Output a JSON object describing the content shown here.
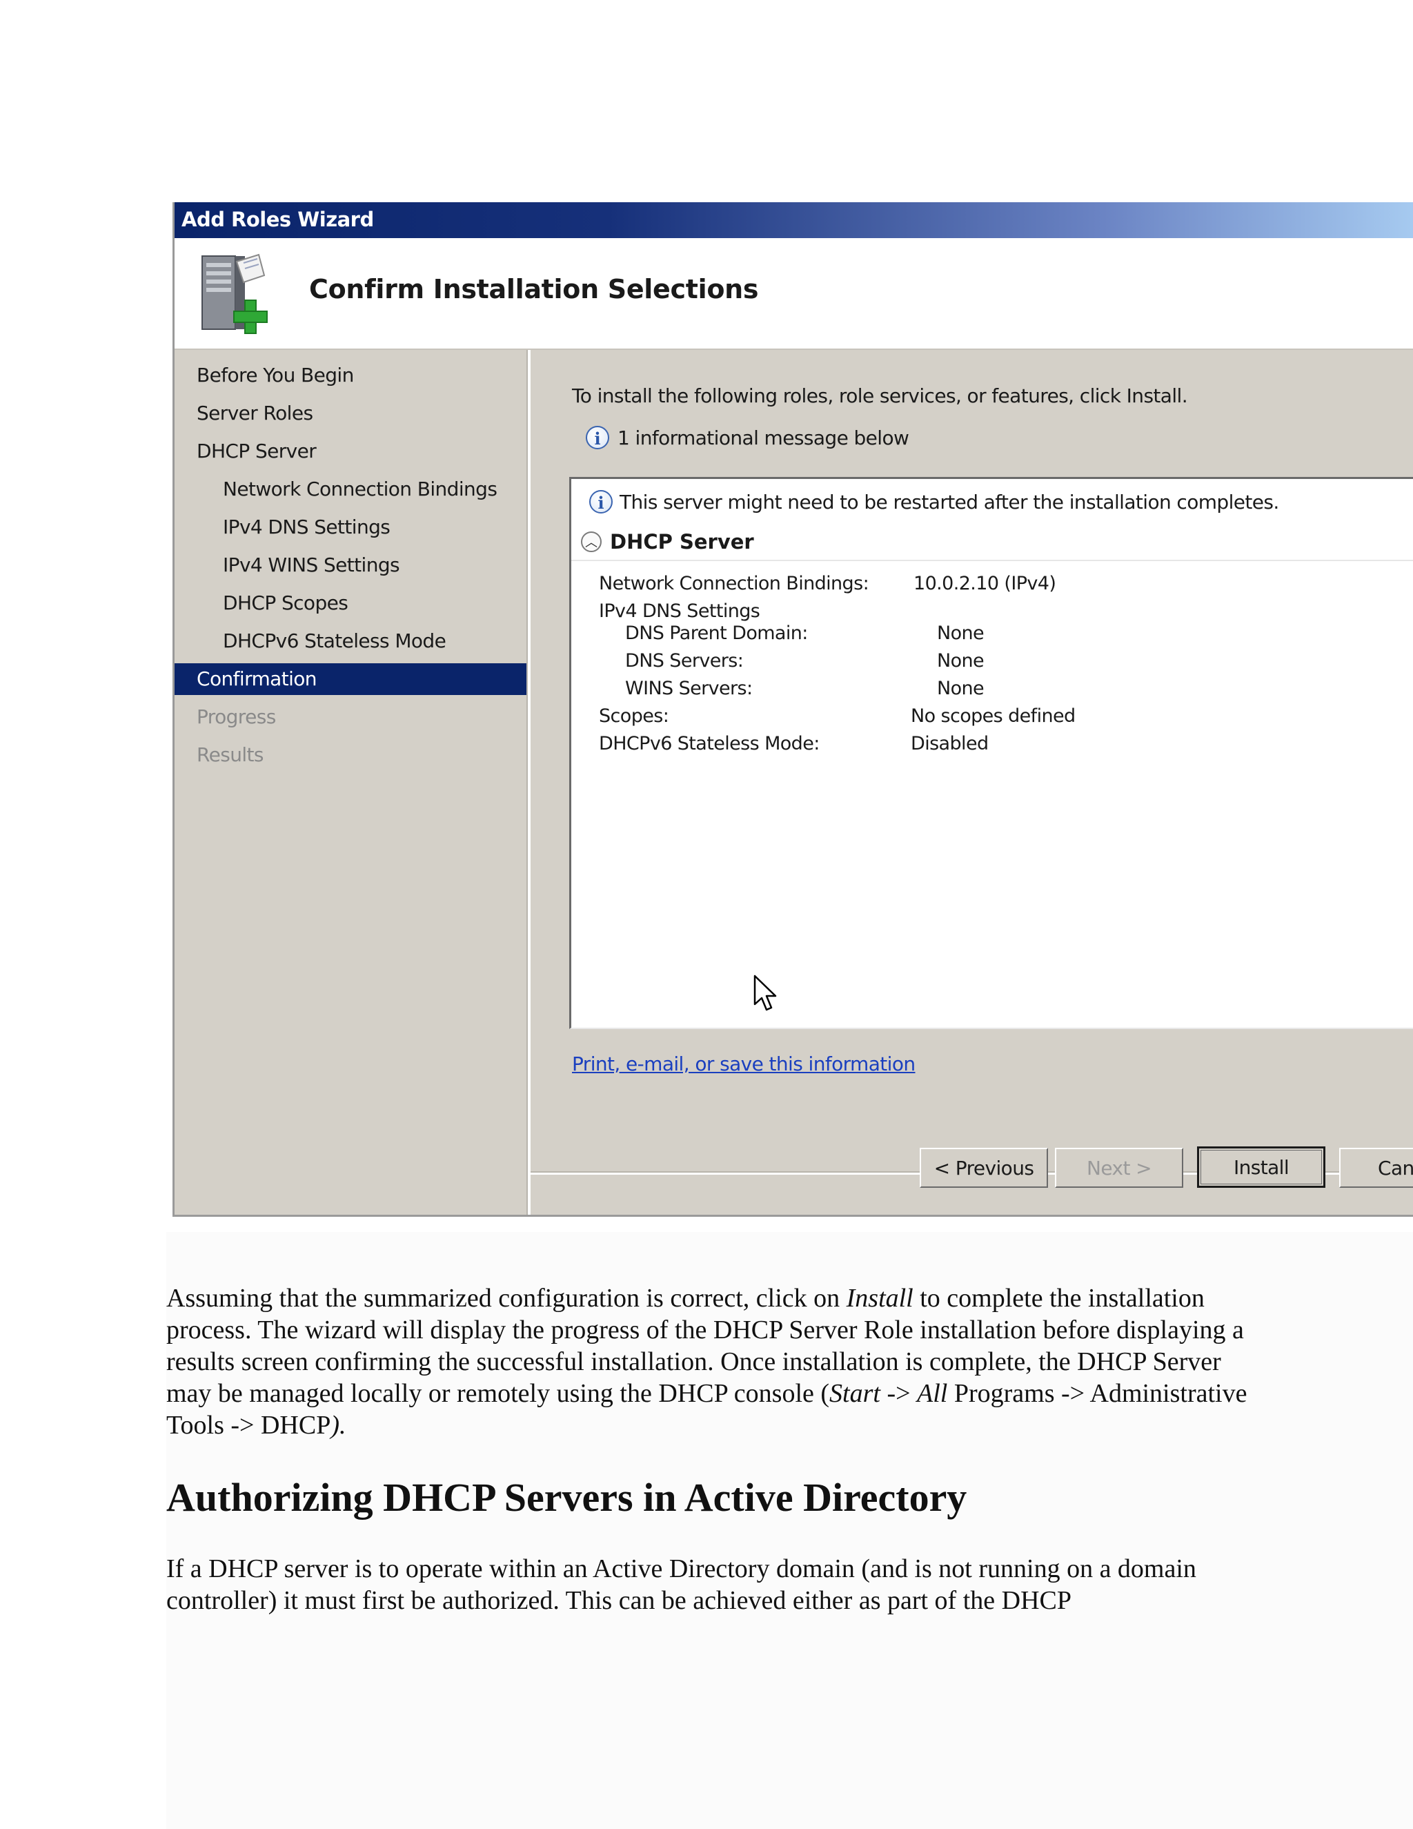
{
  "wizard": {
    "title": "Add Roles Wizard",
    "page_title": "Confirm Installation Selections",
    "nav": [
      {
        "label": "Before You Begin",
        "state": "normal"
      },
      {
        "label": "Server Roles",
        "state": "normal"
      },
      {
        "label": "DHCP Server",
        "state": "normal"
      },
      {
        "label": "Network Connection Bindings",
        "state": "sub"
      },
      {
        "label": "IPv4 DNS Settings",
        "state": "sub"
      },
      {
        "label": "IPv4 WINS Settings",
        "state": "sub"
      },
      {
        "label": "DHCP Scopes",
        "state": "sub"
      },
      {
        "label": "DHCPv6 Stateless Mode",
        "state": "sub"
      },
      {
        "label": "Confirmation",
        "state": "active"
      },
      {
        "label": "Progress",
        "state": "disabled"
      },
      {
        "label": "Results",
        "state": "disabled"
      }
    ],
    "intro": "To install the following roles, role services, or features, click Install.",
    "info_count": "1 informational message below",
    "restart_msg": "This server might need to be restarted after the installation completes.",
    "section_title": "DHCP Server",
    "details": {
      "bindings_label": "Network Connection Bindings:",
      "bindings_value": "10.0.2.10 (IPv4)",
      "dns_settings_label": "IPv4 DNS Settings",
      "parent_domain_label": "DNS Parent Domain:",
      "parent_domain_value": "None",
      "dns_servers_label": "DNS Servers:",
      "dns_servers_value": "None",
      "wins_servers_label": "WINS Servers:",
      "wins_servers_value": "None",
      "scopes_label": "Scopes:",
      "scopes_value": "No scopes defined",
      "stateless_label": "DHCPv6 Stateless Mode:",
      "stateless_value": "Disabled"
    },
    "print_link": "Print, e-mail, or save this information",
    "buttons": {
      "previous": "< Previous",
      "next": "Next >",
      "install": "Install",
      "cancel": "Canc"
    }
  },
  "document": {
    "para1": {
      "t1": "Assuming that the summarized configuration is correct, click on ",
      "i1": "Install",
      "t2": " to complete the installation process. The wizard will display the progress of the DHCP Server Role installation before displaying a results screen confirming the successful installation. Once installation is complete, the DHCP Server may be managed locally or remotely using the DHCP console (",
      "i2": "Start",
      "t3": " -> ",
      "i3": "All",
      "t4": " Programs -> Administrative Tools -> DHCP",
      "i4": ")."
    },
    "heading": "Authorizing DHCP Servers in Active Directory",
    "para2": "If a DHCP server is to operate within an Active Directory domain (and is not running on a domain controller) it must first be authorized. This can be achieved either as part of the DHCP"
  }
}
